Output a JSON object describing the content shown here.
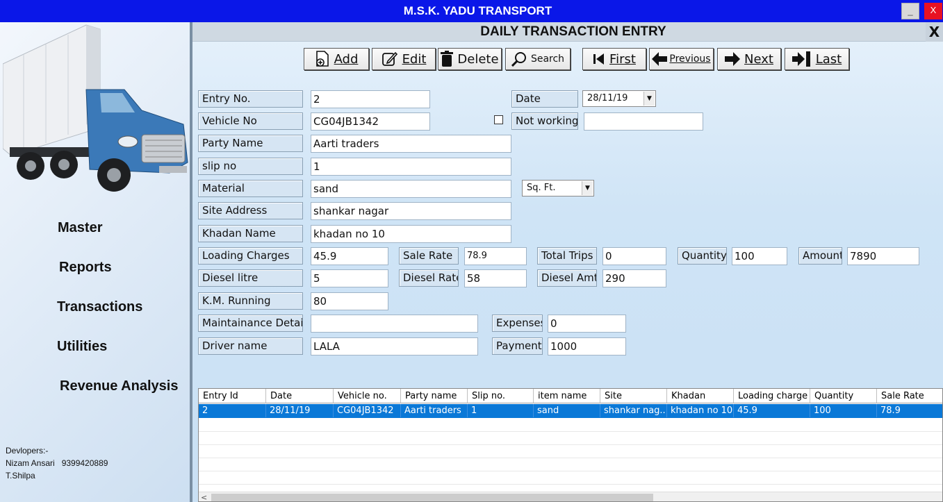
{
  "window": {
    "title": "M.S.K. YADU TRANSPORT",
    "minimize": "_",
    "close": "X"
  },
  "sidebar": {
    "menu": [
      "Master",
      "Reports",
      "Transactions",
      "Utilities",
      "Revenue Analysis"
    ],
    "developers": [
      "Devlopers:-",
      "Nizam Ansari   9399420889",
      "T.Shilpa"
    ]
  },
  "form": {
    "title": "DAILY TRANSACTION ENTRY",
    "close": "X",
    "toolbar": {
      "add": "Add",
      "edit": "Edit",
      "delete": "Delete",
      "search": "Search",
      "first": "First",
      "previous": "Previous",
      "next": "Next",
      "last": "Last"
    },
    "fields": {
      "entry_no": {
        "label": "Entry No.",
        "value": "2"
      },
      "date": {
        "label": "Date",
        "value": "28/11/19"
      },
      "vehicle_no": {
        "label": "Vehicle No",
        "value": "CG04JB1342"
      },
      "not_working": {
        "label": "Not working",
        "value": "",
        "checked": false
      },
      "party_name": {
        "label": "Party Name",
        "value": "Aarti traders"
      },
      "slip_no": {
        "label": "slip no",
        "value": "1"
      },
      "material": {
        "label": "Material",
        "value": "sand",
        "unit": "Sq. Ft."
      },
      "site_address": {
        "label": "Site Address",
        "value": "shankar nagar"
      },
      "khadan_name": {
        "label": "Khadan Name",
        "value": "khadan no 10"
      },
      "loading_charges": {
        "label": "Loading Charges",
        "value": "45.9"
      },
      "sale_rate": {
        "label": "Sale Rate",
        "value": "78.9"
      },
      "total_trips": {
        "label": "Total Trips",
        "value": "0"
      },
      "quantity": {
        "label": "Quantity",
        "value": "100"
      },
      "amount": {
        "label": "Amount",
        "value": "7890"
      },
      "diesel_litre": {
        "label": "Diesel litre",
        "value": "5"
      },
      "diesel_rate": {
        "label": "Diesel Rate",
        "value": "58"
      },
      "diesel_amt": {
        "label": "Diesel Amt.",
        "value": "290"
      },
      "km_running": {
        "label": "K.M. Running",
        "value": "80"
      },
      "maintainance_detail": {
        "label": "Maintainance  Detail",
        "value": ""
      },
      "expenses": {
        "label": "Expenses",
        "value": "0"
      },
      "driver_name": {
        "label": "Driver name",
        "value": "LALA"
      },
      "payment": {
        "label": "Payment",
        "value": "1000"
      }
    }
  },
  "grid": {
    "columns": [
      "Entry Id",
      "Date",
      "Vehicle no.",
      "Party name",
      "Slip no.",
      "item name",
      "Site",
      "Khadan",
      "Loading charge",
      "Quantity",
      "Sale Rate"
    ],
    "rows": [
      [
        "2",
        "28/11/19",
        "CG04JB1342",
        "Aarti traders",
        "1",
        "sand",
        "shankar nag...",
        "khadan no 10",
        "45.9",
        "100",
        "78.9"
      ]
    ],
    "selected_row_color": "#0a78d7"
  },
  "colors": {
    "titlebar": "#0a17e8",
    "close": "#e81123"
  }
}
